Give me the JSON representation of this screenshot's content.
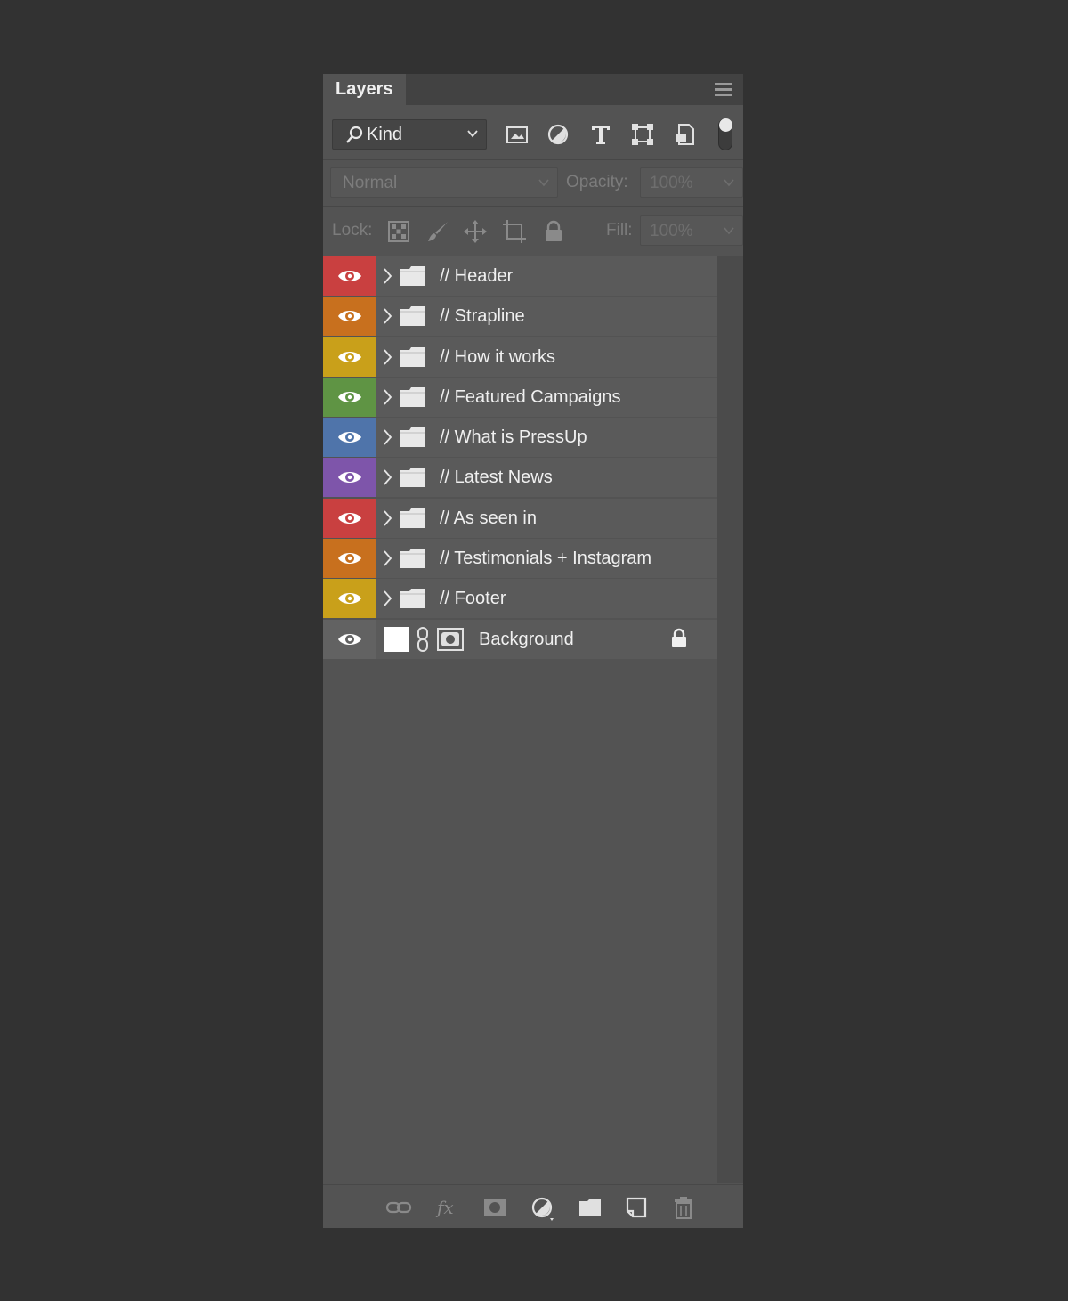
{
  "panel": {
    "tab_label": "Layers"
  },
  "filter": {
    "kind_label": "Kind",
    "icons": [
      "pixel-filter-icon",
      "adjustment-filter-icon",
      "type-filter-icon",
      "shape-filter-icon",
      "smart-object-filter-icon"
    ]
  },
  "blend": {
    "mode": "Normal",
    "opacity_label": "Opacity:",
    "opacity_value": "100%"
  },
  "lock": {
    "label": "Lock:",
    "fill_label": "Fill:",
    "fill_value": "100%",
    "icons": [
      "lock-transparent-icon",
      "lock-pixels-icon",
      "lock-position-icon",
      "lock-artboard-icon",
      "lock-all-icon"
    ]
  },
  "layers": [
    {
      "name": "// Header",
      "color": "#c94040"
    },
    {
      "name": "// Strapline",
      "color": "#c8701e"
    },
    {
      "name": "// How it works",
      "color": "#c9a01a"
    },
    {
      "name": "// Featured Campaigns",
      "color": "#5f9444"
    },
    {
      "name": "// What is PressUp",
      "color": "#4f74aa"
    },
    {
      "name": "// Latest News",
      "color": "#7e55aa"
    },
    {
      "name": "// As seen in",
      "color": "#c94040"
    },
    {
      "name": "// Testimonials + Instagram",
      "color": "#c8701e"
    },
    {
      "name": "// Footer",
      "color": "#c9a01a"
    }
  ],
  "background_layer": {
    "name": "Background",
    "color": "#626262",
    "locked": true
  },
  "bottom_icons": [
    "link-layers-icon",
    "fx-icon",
    "add-mask-icon",
    "new-adjustment-icon",
    "new-group-icon",
    "new-layer-icon",
    "delete-icon"
  ]
}
